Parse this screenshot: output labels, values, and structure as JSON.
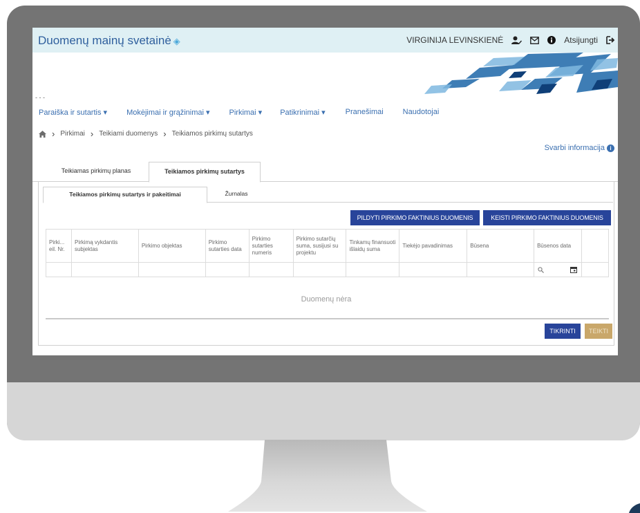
{
  "header": {
    "site_title": "Duomenų mainų svetainė",
    "user_name": "VIRGINIJA LEVINSKIENĖ",
    "logout_label": "Atsijungti"
  },
  "nav": {
    "items": [
      {
        "label": "Paraiška ir sutartis ▾"
      },
      {
        "label": "Mokėjimai ir grąžinimai ▾"
      },
      {
        "label": "Pirkimai ▾"
      },
      {
        "label": "Patikrinimai ▾"
      },
      {
        "label": "Pranešimai"
      },
      {
        "label": "Naudotojai"
      }
    ]
  },
  "breadcrumb": {
    "items": [
      "Pirkimai",
      "Teikiami duomenys",
      "Teikiamos pirkimų sutartys"
    ]
  },
  "info_link": "Svarbi informacija",
  "tabs": [
    {
      "label": "Teikiamas pirkimų planas"
    },
    {
      "label": "Teikiamos pirkimų sutartys"
    }
  ],
  "subtabs": [
    {
      "label": "Teikiamos pirkimų sutartys ir pakeitimai"
    },
    {
      "label": "Žurnalas"
    }
  ],
  "actions": {
    "fill_label": "PILDYTI PIRKIMO FAKTINIUS DUOMENIS",
    "edit_label": "KEISTI PIRKIMO FAKTINIUS DUOMENIS",
    "check_label": "TIKRINTI",
    "submit_label": "TEIKTI"
  },
  "table": {
    "columns": [
      "Pirki... eil. Nr.",
      "Pirkimą vykdantis subjektas",
      "Pirkimo objektas",
      "Pirkimo sutarties data",
      "Pirkimo sutarties numeris",
      "Pirkimo sutarčių suma, susijusi su projektu",
      "Tinkamų finansuoti išlaidų suma",
      "Tiekėjo pavadinimas",
      "Būsena",
      "Būsenos data"
    ],
    "empty_message": "Duomenų nėra"
  },
  "colors": {
    "topbar": "#dff0f4",
    "accent_blue": "#28449a",
    "link_blue": "#3a6fb0",
    "submit_gold": "#c9a76a"
  },
  "icons": [
    "layers-icon",
    "user-edit-icon",
    "envelope-icon",
    "info-icon",
    "logout-icon",
    "home-icon",
    "search-icon",
    "calendar-icon"
  ]
}
